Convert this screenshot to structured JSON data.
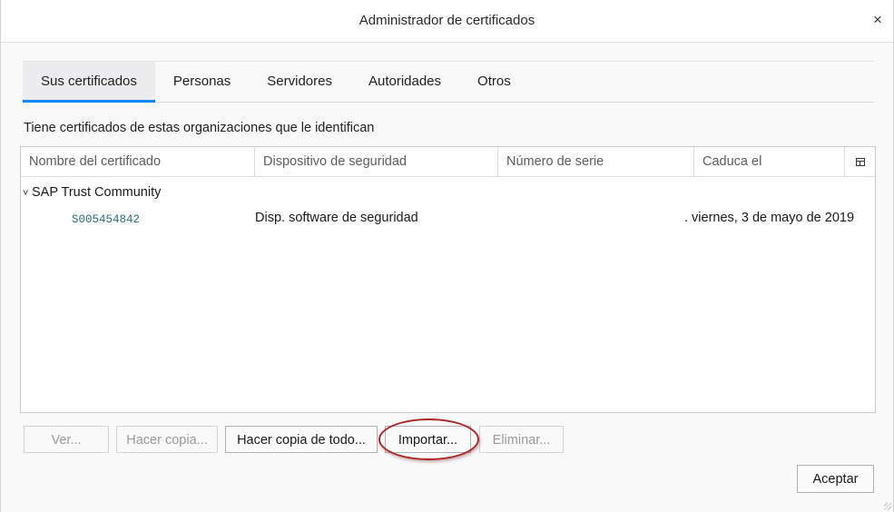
{
  "window": {
    "title": "Administrador de certificados",
    "close_glyph": "×"
  },
  "tabs": [
    {
      "label": "Sus certificados",
      "selected": true
    },
    {
      "label": "Personas",
      "selected": false
    },
    {
      "label": "Servidores",
      "selected": false
    },
    {
      "label": "Autoridades",
      "selected": false
    },
    {
      "label": "Otros",
      "selected": false
    }
  ],
  "description": "Tiene certificados de estas organizaciones que le identifican",
  "tree": {
    "columns": [
      "Nombre del certificado",
      "Dispositivo de seguridad",
      "Número de serie",
      "Caduca el"
    ],
    "column_picker_icon": "column-picker-icon",
    "groups": [
      {
        "name": "SAP Trust Community",
        "expanded": true,
        "twisty": "˅",
        "certificates": [
          {
            "name": "S005454842",
            "device": "Disp. software de seguridad",
            "serial": "",
            "expires": ". viernes, 3 de mayo de 2019"
          }
        ]
      }
    ]
  },
  "buttons": {
    "view": {
      "label": "Ver...",
      "enabled": false
    },
    "backup": {
      "label": "Hacer copia...",
      "enabled": false
    },
    "backup_all": {
      "label": "Hacer copia de todo...",
      "enabled": true
    },
    "import": {
      "label": "Importar...",
      "enabled": true
    },
    "delete": {
      "label": "Eliminar...",
      "enabled": false
    },
    "ok": {
      "label": "Aceptar",
      "enabled": true
    }
  },
  "colors": {
    "tab_accent": "#0a84ff",
    "highlight_annotation": "#a82a2a",
    "cert_name": "#2a6f77"
  }
}
